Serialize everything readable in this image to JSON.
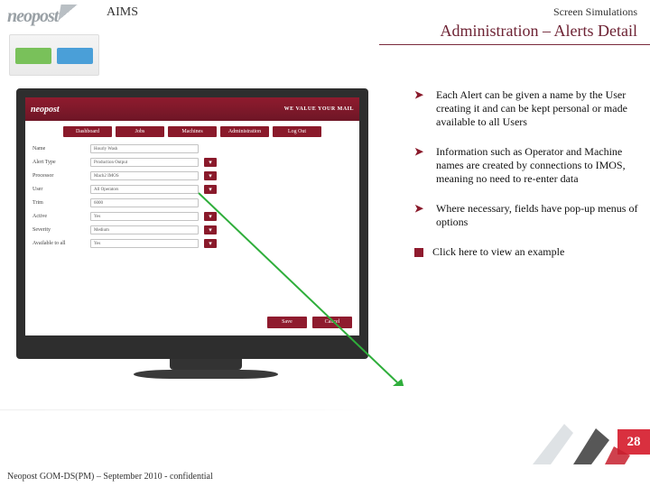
{
  "header": {
    "brand": "neopost",
    "app": "AIMS",
    "sim": "Screen Simulations",
    "title": "Administration – Alerts Detail"
  },
  "screen": {
    "topbar_brand": "neopost",
    "topbar_tagline": "WE VALUE YOUR MAIL",
    "tabs": [
      "Dashboard",
      "Jobs",
      "Machines",
      "Administration",
      "Log Out"
    ],
    "form": [
      {
        "label": "Name",
        "value": "Hourly Wash",
        "combo": false
      },
      {
        "label": "Alert Type",
        "value": "Production Output",
        "combo": true
      },
      {
        "label": "Processor",
        "value": "Mach2 IMOS",
        "combo": true
      },
      {
        "label": "User",
        "value": "All Operators",
        "combo": true
      },
      {
        "label": "Trim",
        "value": "6000",
        "combo": false
      },
      {
        "label": "Active",
        "value": "Yes",
        "combo": true
      },
      {
        "label": "Severity",
        "value": "Medium",
        "combo": true
      },
      {
        "label": "Available to all",
        "value": "Yes",
        "combo": true
      }
    ],
    "buttons": {
      "save": "Save",
      "cancel": "Cancel"
    }
  },
  "bullets": [
    "Each Alert can be given a name by the User creating it and can be kept personal or made available to all Users",
    "Information such as Operator and Machine names are created by connections to IMOS, meaning no need to re-enter data",
    "Where necessary, fields have pop-up menus of options"
  ],
  "cta": "Click here to view an example",
  "page_number": "28",
  "footer": "Neopost GOM-DS(PM) – September 2010 - confidential"
}
